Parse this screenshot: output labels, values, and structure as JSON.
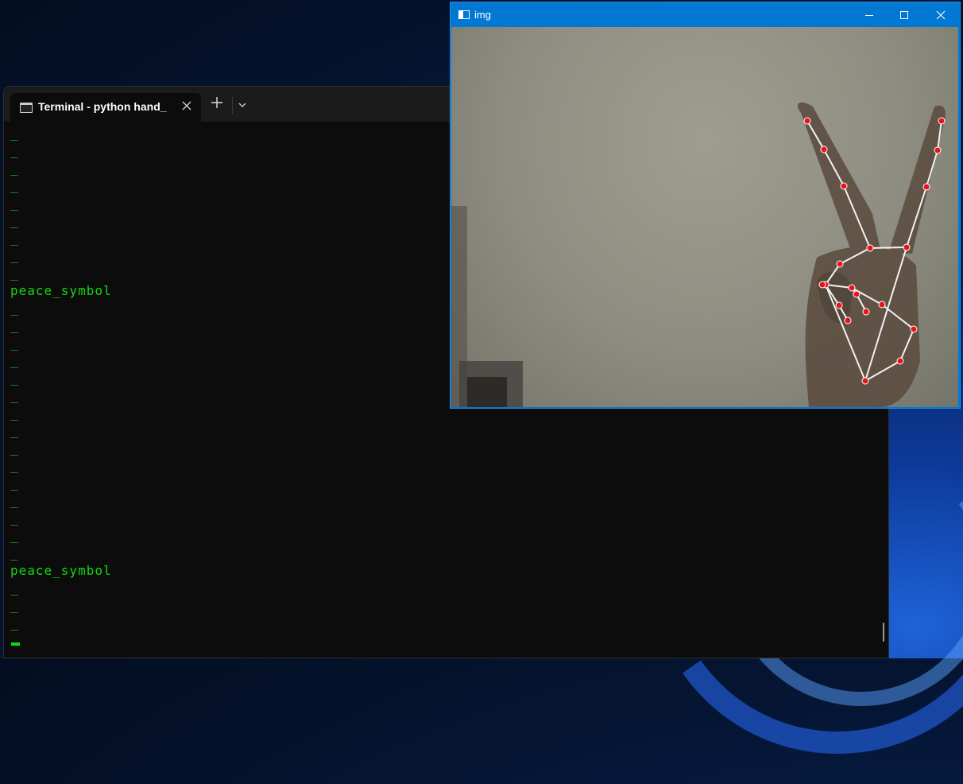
{
  "terminal": {
    "tab_title": "Terminal - python  hand_",
    "lines": [
      "_",
      "_",
      "_",
      "_",
      "_",
      "_",
      "_",
      "_",
      "_",
      "peace_symbol",
      "_",
      "_",
      "_",
      "_",
      "_",
      "_",
      "_",
      "_",
      "_",
      "_",
      "_",
      "_",
      "_",
      "_",
      "_",
      "peace_symbol",
      "_",
      "_",
      "_"
    ],
    "text_color": "#13d813",
    "icons": {
      "tab": "terminal-icon",
      "close": "close-icon",
      "new_tab": "plus-icon",
      "dropdown": "chevron-down-icon"
    }
  },
  "image_window": {
    "title": "img",
    "icons": {
      "app": "window-icon",
      "minimize": "minimize-icon",
      "maximize": "maximize-icon",
      "close": "close-icon"
    },
    "titlebar_color": "#0078d4",
    "landmark_color": "#e8141b",
    "connection_color": "#f2f2f2"
  }
}
